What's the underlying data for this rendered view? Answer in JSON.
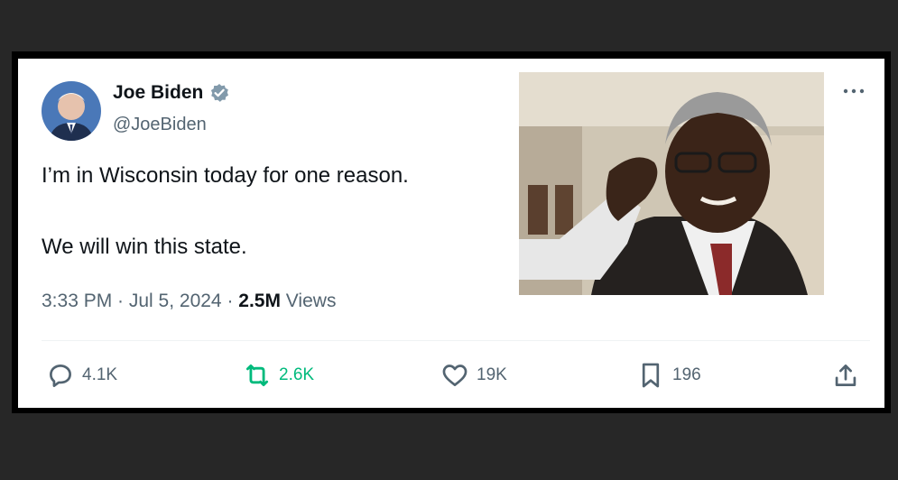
{
  "author": {
    "name": "Joe Biden",
    "handle": "@JoeBiden"
  },
  "tweet": {
    "line1": "I’m in Wisconsin today for one reason.",
    "line2": "We will win this state."
  },
  "meta": {
    "timestamp": "3:33 PM · Jul 5, 2024 · ",
    "views_count": "2.5M",
    "views_label": " Views"
  },
  "actions": {
    "replies": "4.1K",
    "retweets": "2.6K",
    "likes": "19K",
    "bookmarks": "196"
  },
  "colors": {
    "retweet_active": "#00ba7c",
    "verified": "#829aab",
    "secondary_text": "#536471"
  },
  "icons": [
    "verified-badge-icon",
    "more-options-icon",
    "reply-icon",
    "retweet-icon",
    "like-icon",
    "bookmark-icon",
    "share-icon"
  ]
}
